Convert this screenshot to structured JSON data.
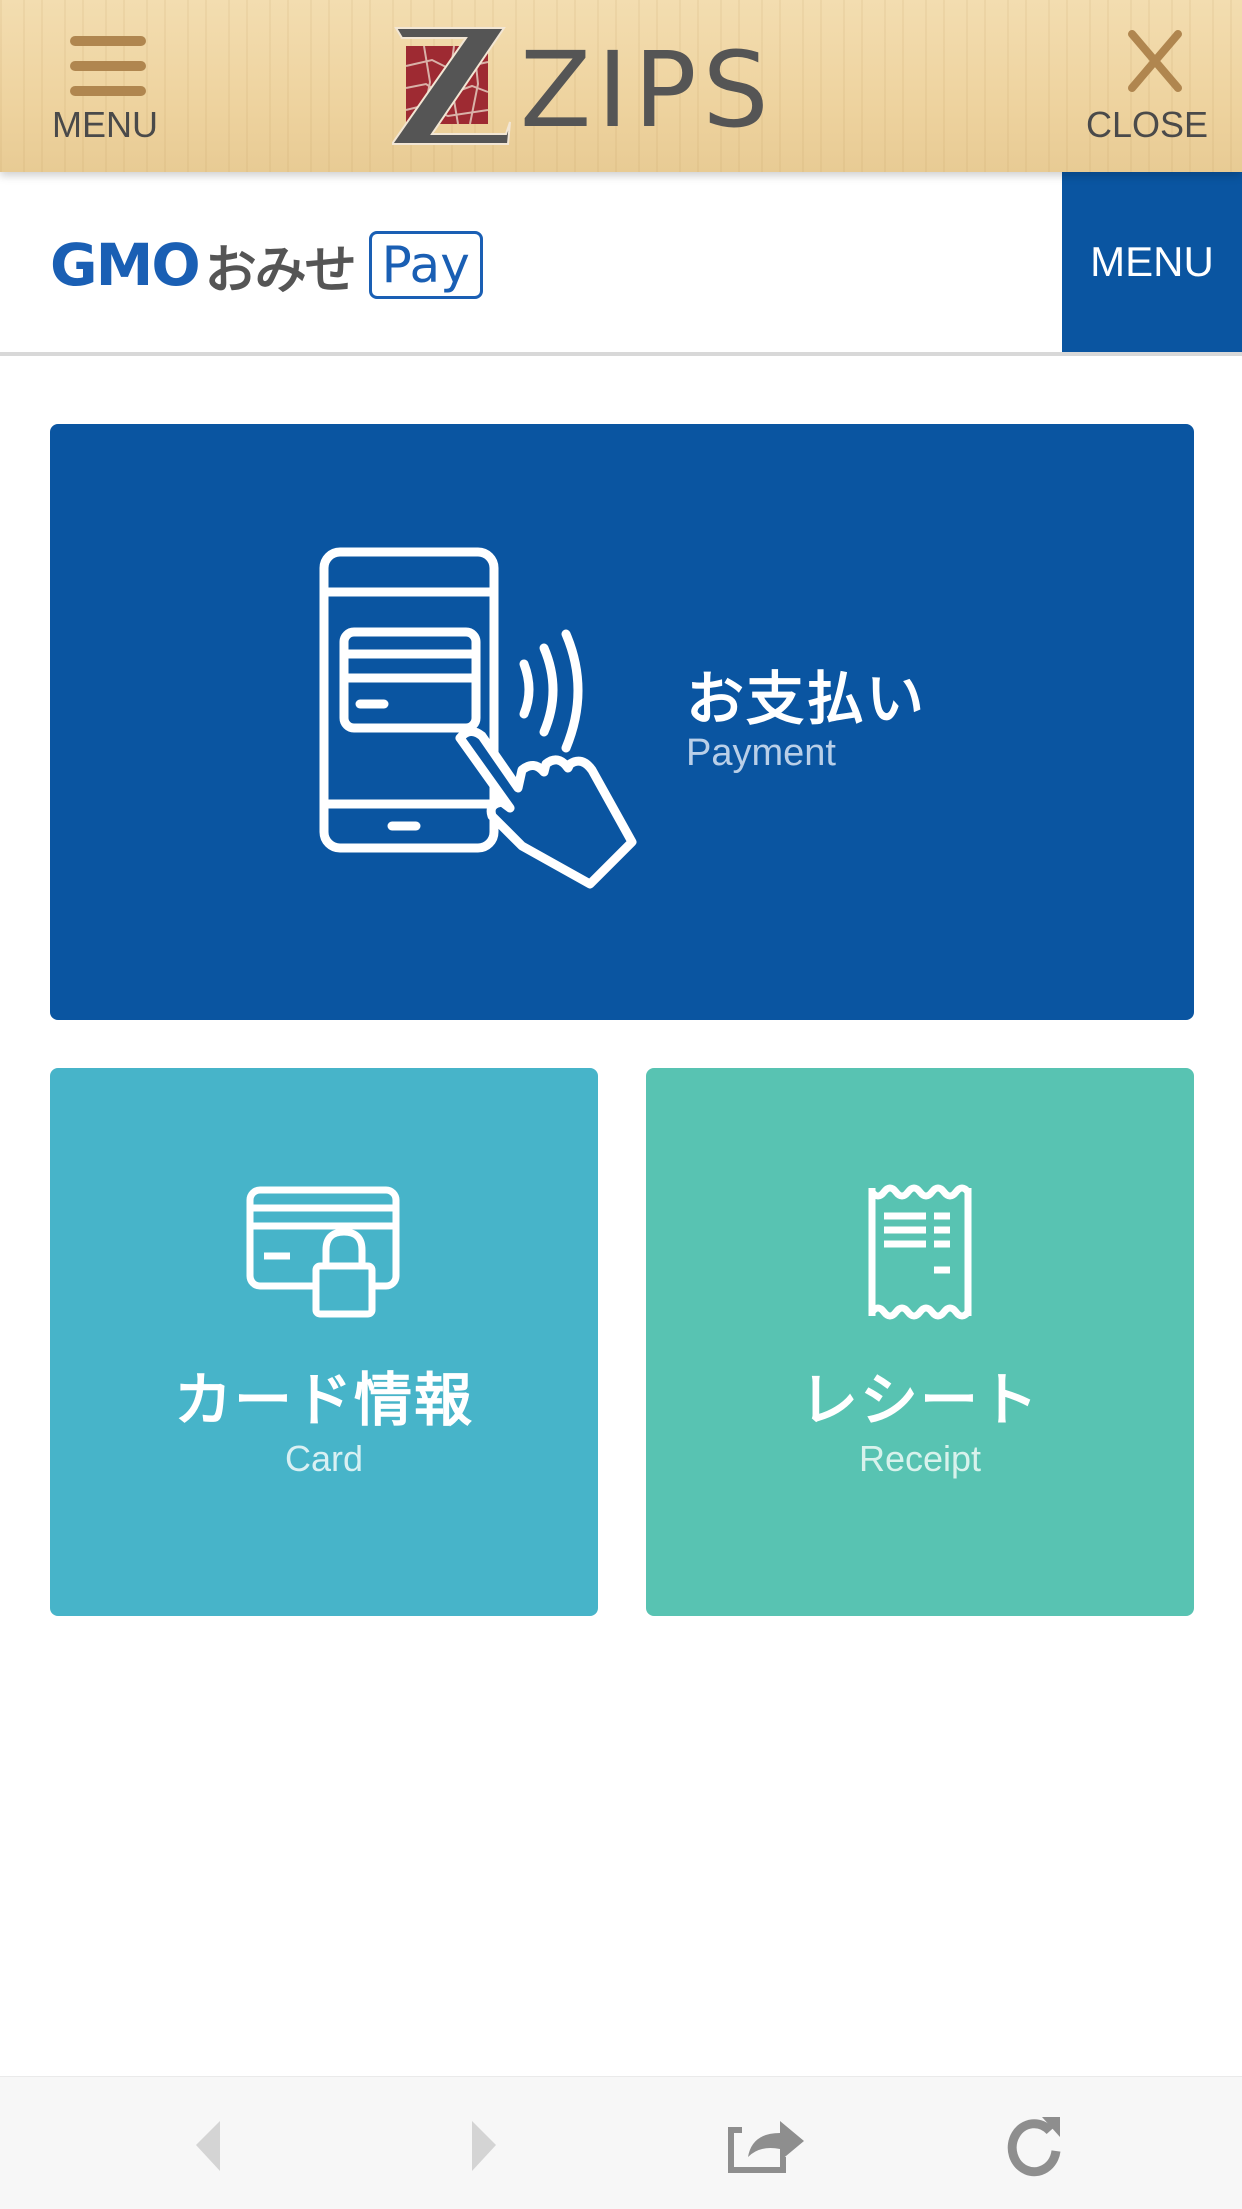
{
  "topbar": {
    "menu_label": "MENU",
    "close_label": "CLOSE",
    "logo_text": "ZIPS",
    "icons": {
      "menu": "hamburger-icon",
      "close": "close-icon"
    },
    "accent_color": "#b0864f"
  },
  "subheader": {
    "brand": "GMO",
    "brand_jp": "おみせ",
    "brand_pay": "Pay",
    "menu_label": "MENU",
    "brand_color": "#0a55a1"
  },
  "tiles": {
    "payment": {
      "title": "お支払い",
      "subtitle": "Payment",
      "icon": "phone-tap-payment-icon",
      "color": "#0a55a1"
    },
    "card": {
      "title": "カード情報",
      "subtitle": "Card",
      "icon": "card-lock-icon",
      "color": "#47b4c9"
    },
    "receipt": {
      "title": "レシート",
      "subtitle": "Receipt",
      "icon": "receipt-icon",
      "color": "#58c3b2"
    }
  },
  "toolbar": {
    "buttons": [
      {
        "name": "back",
        "icon": "back-arrow-icon",
        "enabled": false
      },
      {
        "name": "forward",
        "icon": "forward-arrow-icon",
        "enabled": false
      },
      {
        "name": "share",
        "icon": "share-icon",
        "enabled": true
      },
      {
        "name": "reload",
        "icon": "reload-icon",
        "enabled": true
      }
    ]
  }
}
